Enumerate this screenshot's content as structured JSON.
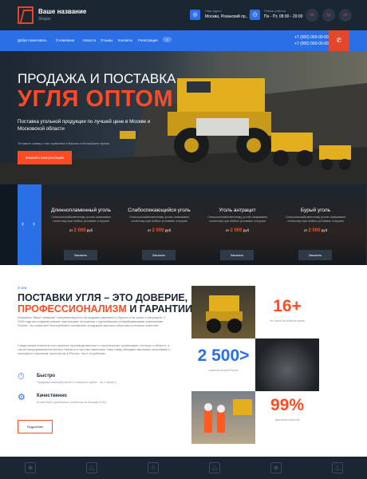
{
  "header": {
    "brand": "Ваше название",
    "brand_sub": "Slogan",
    "address_label": "Наш адрес:",
    "address": "Москва, Рязанский пр., 15",
    "hours_label": "Режим работы:",
    "hours": "Пн - Пт, 08:00 - 20:00",
    "social": [
      "vk",
      "tg",
      "ok"
    ]
  },
  "nav": {
    "items": [
      "Добро пожаловать",
      "О компании",
      "Новости",
      "Отзывы",
      "Контакты",
      "Регистрация"
    ],
    "search_label": "⌕",
    "phone1": "+7 (000) 000-00-00",
    "phone2": "+7 (000) 000-00-00"
  },
  "hero": {
    "title1": "ПРОДАЖА И ПОСТАВКА",
    "title2": "УГЛЯ ОПТОМ",
    "subtitle": "Поставка угольной продукции по лучшей цене в Москве и Московской области",
    "note": "Оставьте заявку и мы привезём в Вашем в ближайшее время",
    "button": "Заказать консультацию"
  },
  "coal": {
    "cards": [
      {
        "title": "Длиннопламенный уголь",
        "desc": "Сельскохозяйственному уголю оказываем логистику при любых условиях отгрузки",
        "price_prefix": "от",
        "price": "2 000",
        "unit": "руб",
        "button": "Заказать"
      },
      {
        "title": "Слабоспекающийся уголь",
        "desc": "Сельскохозяйственному уголю оказываем логистику при любых условиях отгрузки",
        "price_prefix": "от",
        "price": "2 000",
        "unit": "руб",
        "button": "Заказать"
      },
      {
        "title": "Уголь антрацит",
        "desc": "Сельскохозяйственному уголю оказываем логистику при любых условиях отгрузки",
        "price_prefix": "от",
        "price": "2 000",
        "unit": "руб",
        "button": "Заказать"
      },
      {
        "title": "Бурый уголь",
        "desc": "Сельскохозяйственному уголю оказываем логистику при любых условиях отгрузки",
        "price_prefix": "от",
        "price": "2 000",
        "unit": "руб",
        "button": "Заказать"
      }
    ]
  },
  "about": {
    "tag": "О нас",
    "h1": "ПОСТАВКИ УГЛЯ – ЭТО ДОВЕРИЕ,",
    "h2_orange": "ПРОФЕССИОНАЛИЗМ",
    "h2_rest": " И ГАРАНТИИ",
    "p1": "Компания \"Ваше название\" специализируется на продаже каменного и бурого угля, кокса и антрацита. С 2006 года мы создаем равные партнерские отношения с крупнейшими угледобывающими компаниями России, что позволяет бесперебойно поставлять продукцию высокого качества в регионы клиентов.",
    "p2": "Среди наших клиентов есть крупные производственные и строительные организации столицы и области, а так же предприниматели малого бизнеса и частные заказчики. Наш товар обладает высокими качествами и пользуется огромным спросом как в России, так и за рубежом.",
    "features": [
      {
        "title": "Быстро",
        "desc": "Предварительный расчёт стоимости работ - за 1 минуту"
      },
      {
        "title": "Качественно",
        "desc": "Более 6000 довольных клиентов по Москве и МО"
      }
    ],
    "button": "Подробнее"
  },
  "stats": [
    {
      "num": "16+",
      "label": "лет опыта на угольном рынке"
    },
    {
      "num": "2 500>",
      "label": "клиентов по всей России"
    },
    {
      "num": "99%",
      "label": "довольных клиентов"
    }
  ],
  "colors": {
    "accent": "#ff4b23",
    "blue": "#2a6fe5",
    "dark": "#1b2633"
  }
}
